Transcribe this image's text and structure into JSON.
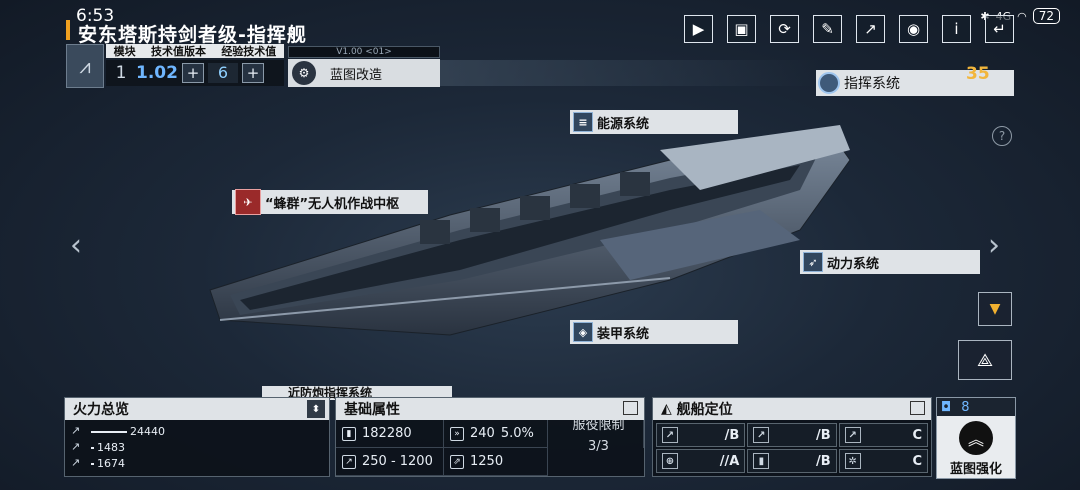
{
  "status": {
    "time": "6:53",
    "signal": "4G",
    "battery": "72"
  },
  "title": "安东塔斯持剑者级-指挥舰",
  "version_panel": {
    "headers": [
      "模块",
      "技术值版本",
      "经验技术值"
    ],
    "module": "1",
    "tech_version": "1.02",
    "exp_value": "6",
    "plus_symbol": "+",
    "logo_icon": "ship-class-icon"
  },
  "blueprint": {
    "version": "V1.00 <01>",
    "label": "蓝图改造",
    "icon": "blueprint-gear-icon"
  },
  "top_icons": [
    {
      "name": "video-icon",
      "glyph": "▶"
    },
    {
      "name": "gallery-icon",
      "glyph": "▣"
    },
    {
      "name": "rotate-icon",
      "glyph": "⟳"
    },
    {
      "name": "paint-icon",
      "glyph": "✎"
    },
    {
      "name": "share-icon",
      "glyph": "↗"
    },
    {
      "name": "view-icon",
      "glyph": "◉"
    },
    {
      "name": "info-icon",
      "glyph": "i"
    },
    {
      "name": "back-icon",
      "glyph": "↵"
    }
  ],
  "command_system": {
    "label": "指挥系统",
    "value": "35"
  },
  "help": "?",
  "systems": {
    "energy": "能源系统",
    "drone": "“蜂群”无人机作战中枢",
    "power": "动力系统",
    "armor": "装甲系统",
    "partial": "近防炮指挥系统"
  },
  "nav": {
    "left": "‹",
    "right": "›"
  },
  "fire_panel": {
    "title": "火力总览",
    "rows": [
      {
        "value": "24440",
        "fraction": 1.0
      },
      {
        "value": "1483",
        "fraction": 0.06
      },
      {
        "value": "1674",
        "fraction": 0.07
      }
    ]
  },
  "base_panel": {
    "title": "基础属性",
    "hp": "182280",
    "armor": "240",
    "evasion_pct": "5.0%",
    "speed": "250 - 1200",
    "warp": "1250",
    "service_label": "服役限制",
    "service_value": "3/3"
  },
  "position_panel": {
    "title": "舰船定位",
    "cells": [
      {
        "icon": "anti-ship-icon",
        "grade": "/B"
      },
      {
        "icon": "anti-aircraft-icon",
        "grade": "/B"
      },
      {
        "icon": "siege-icon",
        "grade": "C"
      },
      {
        "icon": "support-icon",
        "grade": "//A"
      },
      {
        "icon": "defense-icon",
        "grade": "/B"
      },
      {
        "icon": "utility-icon",
        "grade": "C"
      }
    ]
  },
  "enhance": {
    "count": "8",
    "label": "蓝图强化"
  }
}
